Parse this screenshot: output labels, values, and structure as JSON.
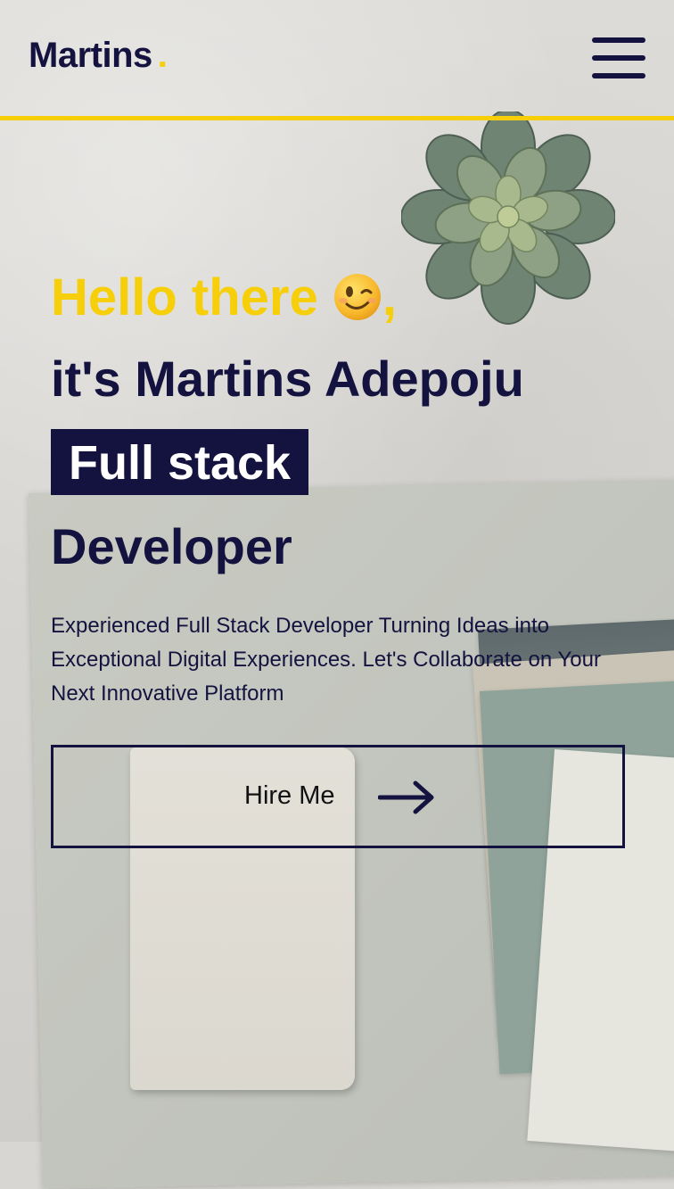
{
  "header": {
    "logo_text": "Martins",
    "logo_dot": ".",
    "menu_icon": "hamburger-menu-icon"
  },
  "hero": {
    "greeting": "Hello there",
    "greeting_emoji": "winking-face-icon",
    "greeting_suffix": ",",
    "name_line": "it's Martins Adepoju",
    "role_highlight": "Full stack",
    "role_rest": "Developer",
    "description": "Experienced Full Stack Developer Turning Ideas into Exceptional Digital Experiences. Let's Collaborate on Your Next Innovative Platform",
    "cta_label": "Hire Me",
    "cta_icon": "arrow-right-icon"
  },
  "colors": {
    "accent": "#f6cf0a",
    "navy": "#14123f",
    "white": "#ffffff"
  }
}
